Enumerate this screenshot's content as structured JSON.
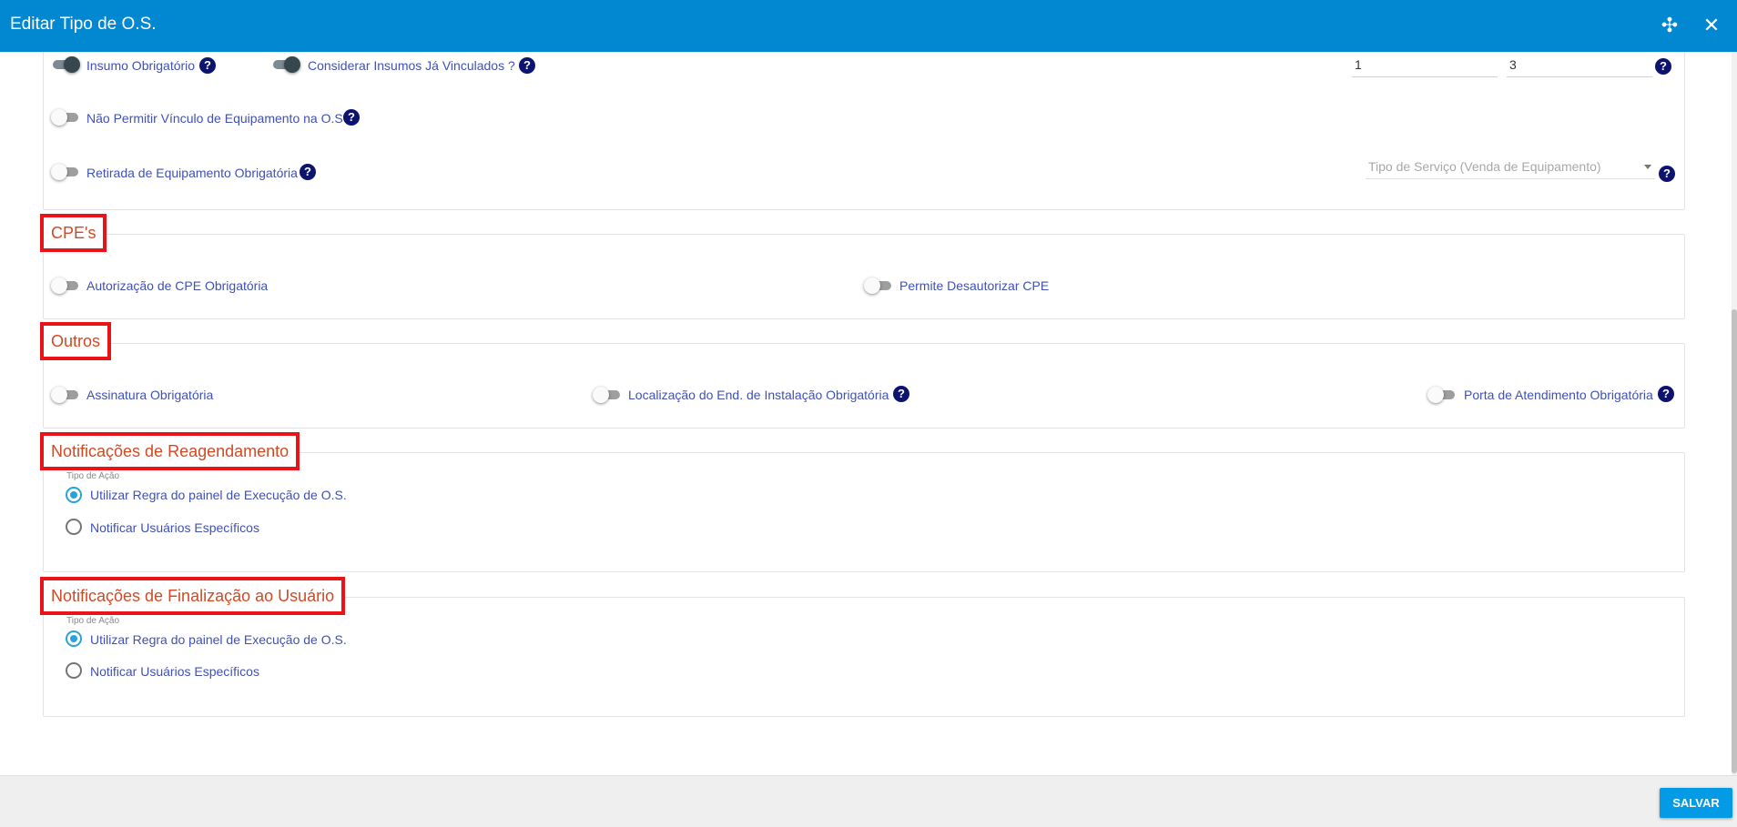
{
  "header": {
    "title": "Editar Tipo de O.S.",
    "collapse_icon": "✣",
    "close_icon": "✕"
  },
  "equipamentos": {
    "insumo_obrigatorio": {
      "label": "Insumo Obrigatório",
      "checked": true
    },
    "considerar_insumos": {
      "label": "Considerar Insumos Já Vinculados ?",
      "checked": true
    },
    "input_1_value": "1",
    "input_2_value": "3",
    "nao_permitir_vinculo": {
      "label": "Não Permitir Vínculo de Equipamento na O.S",
      "checked": false
    },
    "retirada_obrigatoria": {
      "label": "Retirada de Equipamento Obrigatória",
      "checked": false
    },
    "tipo_servico_placeholder": "Tipo de Serviço (Venda de Equipamento)"
  },
  "cpes": {
    "legend": "CPE's",
    "autorizacao": {
      "label": "Autorização de CPE Obrigatória",
      "checked": false
    },
    "permite_desautorizar": {
      "label": "Permite Desautorizar CPE",
      "checked": false
    }
  },
  "outros": {
    "legend": "Outros",
    "assinatura": {
      "label": "Assinatura Obrigatória",
      "checked": false
    },
    "localizacao": {
      "label": "Localização do End. de Instalação Obrigatória",
      "checked": false
    },
    "porta": {
      "label": "Porta de Atendimento Obrigatória",
      "checked": false
    }
  },
  "reagendamento": {
    "legend": "Notificações de Reagendamento",
    "tipo_acao_label": "Tipo de Ação",
    "option_1": "Utilizar Regra do painel de Execução de O.S.",
    "option_2": "Notificar Usuários Específicos",
    "selected": "option_1"
  },
  "finalizacao": {
    "legend": "Notificações de Finalização ao Usuário",
    "tipo_acao_label": "Tipo de Ação",
    "option_1": "Utilizar Regra do painel de Execução de O.S.",
    "option_2": "Notificar Usuários Específicos",
    "selected": "option_1"
  },
  "footer": {
    "save_label": "SALVAR"
  },
  "help_glyph": "?",
  "colors": {
    "header": "#0288d1",
    "accent_radio": "#29a3dc",
    "legend_text": "#d14a24",
    "highlight_box": "#e8141a",
    "label_text": "#3f51b5",
    "help_icon": "#0d1470"
  }
}
